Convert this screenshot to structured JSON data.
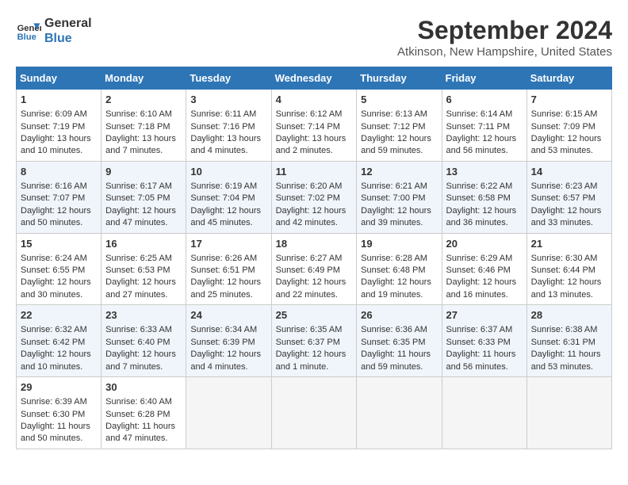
{
  "header": {
    "logo_line1": "General",
    "logo_line2": "Blue",
    "month": "September 2024",
    "location": "Atkinson, New Hampshire, United States"
  },
  "weekdays": [
    "Sunday",
    "Monday",
    "Tuesday",
    "Wednesday",
    "Thursday",
    "Friday",
    "Saturday"
  ],
  "weeks": [
    [
      {
        "day": "1",
        "sunrise": "6:09 AM",
        "sunset": "7:19 PM",
        "daylight": "13 hours and 10 minutes"
      },
      {
        "day": "2",
        "sunrise": "6:10 AM",
        "sunset": "7:18 PM",
        "daylight": "13 hours and 7 minutes"
      },
      {
        "day": "3",
        "sunrise": "6:11 AM",
        "sunset": "7:16 PM",
        "daylight": "13 hours and 4 minutes"
      },
      {
        "day": "4",
        "sunrise": "6:12 AM",
        "sunset": "7:14 PM",
        "daylight": "13 hours and 2 minutes"
      },
      {
        "day": "5",
        "sunrise": "6:13 AM",
        "sunset": "7:12 PM",
        "daylight": "12 hours and 59 minutes"
      },
      {
        "day": "6",
        "sunrise": "6:14 AM",
        "sunset": "7:11 PM",
        "daylight": "12 hours and 56 minutes"
      },
      {
        "day": "7",
        "sunrise": "6:15 AM",
        "sunset": "7:09 PM",
        "daylight": "12 hours and 53 minutes"
      }
    ],
    [
      {
        "day": "8",
        "sunrise": "6:16 AM",
        "sunset": "7:07 PM",
        "daylight": "12 hours and 50 minutes"
      },
      {
        "day": "9",
        "sunrise": "6:17 AM",
        "sunset": "7:05 PM",
        "daylight": "12 hours and 47 minutes"
      },
      {
        "day": "10",
        "sunrise": "6:19 AM",
        "sunset": "7:04 PM",
        "daylight": "12 hours and 45 minutes"
      },
      {
        "day": "11",
        "sunrise": "6:20 AM",
        "sunset": "7:02 PM",
        "daylight": "12 hours and 42 minutes"
      },
      {
        "day": "12",
        "sunrise": "6:21 AM",
        "sunset": "7:00 PM",
        "daylight": "12 hours and 39 minutes"
      },
      {
        "day": "13",
        "sunrise": "6:22 AM",
        "sunset": "6:58 PM",
        "daylight": "12 hours and 36 minutes"
      },
      {
        "day": "14",
        "sunrise": "6:23 AM",
        "sunset": "6:57 PM",
        "daylight": "12 hours and 33 minutes"
      }
    ],
    [
      {
        "day": "15",
        "sunrise": "6:24 AM",
        "sunset": "6:55 PM",
        "daylight": "12 hours and 30 minutes"
      },
      {
        "day": "16",
        "sunrise": "6:25 AM",
        "sunset": "6:53 PM",
        "daylight": "12 hours and 27 minutes"
      },
      {
        "day": "17",
        "sunrise": "6:26 AM",
        "sunset": "6:51 PM",
        "daylight": "12 hours and 25 minutes"
      },
      {
        "day": "18",
        "sunrise": "6:27 AM",
        "sunset": "6:49 PM",
        "daylight": "12 hours and 22 minutes"
      },
      {
        "day": "19",
        "sunrise": "6:28 AM",
        "sunset": "6:48 PM",
        "daylight": "12 hours and 19 minutes"
      },
      {
        "day": "20",
        "sunrise": "6:29 AM",
        "sunset": "6:46 PM",
        "daylight": "12 hours and 16 minutes"
      },
      {
        "day": "21",
        "sunrise": "6:30 AM",
        "sunset": "6:44 PM",
        "daylight": "12 hours and 13 minutes"
      }
    ],
    [
      {
        "day": "22",
        "sunrise": "6:32 AM",
        "sunset": "6:42 PM",
        "daylight": "12 hours and 10 minutes"
      },
      {
        "day": "23",
        "sunrise": "6:33 AM",
        "sunset": "6:40 PM",
        "daylight": "12 hours and 7 minutes"
      },
      {
        "day": "24",
        "sunrise": "6:34 AM",
        "sunset": "6:39 PM",
        "daylight": "12 hours and 4 minutes"
      },
      {
        "day": "25",
        "sunrise": "6:35 AM",
        "sunset": "6:37 PM",
        "daylight": "12 hours and 1 minute"
      },
      {
        "day": "26",
        "sunrise": "6:36 AM",
        "sunset": "6:35 PM",
        "daylight": "11 hours and 59 minutes"
      },
      {
        "day": "27",
        "sunrise": "6:37 AM",
        "sunset": "6:33 PM",
        "daylight": "11 hours and 56 minutes"
      },
      {
        "day": "28",
        "sunrise": "6:38 AM",
        "sunset": "6:31 PM",
        "daylight": "11 hours and 53 minutes"
      }
    ],
    [
      {
        "day": "29",
        "sunrise": "6:39 AM",
        "sunset": "6:30 PM",
        "daylight": "11 hours and 50 minutes"
      },
      {
        "day": "30",
        "sunrise": "6:40 AM",
        "sunset": "6:28 PM",
        "daylight": "11 hours and 47 minutes"
      },
      null,
      null,
      null,
      null,
      null
    ]
  ],
  "labels": {
    "sunrise": "Sunrise:",
    "sunset": "Sunset:",
    "daylight": "Daylight:"
  }
}
